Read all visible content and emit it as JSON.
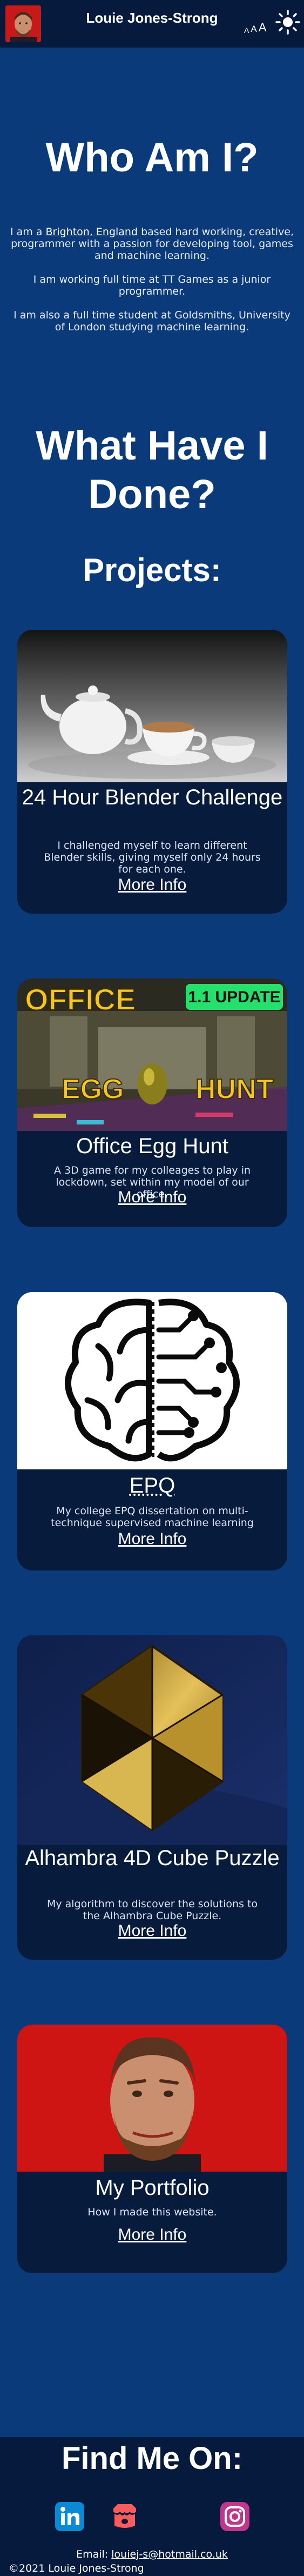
{
  "header": {
    "title": "Louie Jones-Strong",
    "font_size_glyphs": [
      "A",
      "A",
      "A"
    ]
  },
  "intro": {
    "heading": "Who Am I?",
    "p1_before": "I am a ",
    "p1_link": "Brighton, England",
    "p1_after": " based hard working, creative, programmer with a passion for developing tool, games and machine learning.",
    "p2": "I am working full time at TT Games as a junior programmer.",
    "p3": "I am also a full time student at Goldsmiths, University of London studying machine learning."
  },
  "done": {
    "heading": "What Have I Done?",
    "projects_heading": "Projects:"
  },
  "projects": [
    {
      "title": "24 Hour Blender Challenge",
      "description": "I challenged myself to learn different Blender skills, giving myself only 24 hours for each one.",
      "link": "More Info"
    },
    {
      "title": "Office Egg Hunt",
      "description": "A 3D game for my colleages to play in lockdown, set within my model of our office.",
      "link": "More Info",
      "image_text": {
        "office": "OFFICE",
        "egg": "EGG",
        "hunt": "HUNT",
        "badge": "1.1 UPDATE"
      }
    },
    {
      "title": "EPQ",
      "description": "My college EPQ dissertation on multi-technique supervised machine learning",
      "link": "More Info"
    },
    {
      "title": "Alhambra 4D Cube Puzzle",
      "description": "My algorithm to discover the solutions to the Alhambra Cube Puzzle.",
      "link": "More Info"
    },
    {
      "title": "My Portfolio",
      "description": "How I made this website.",
      "link": "More Info"
    }
  ],
  "footer": {
    "heading": "Find Me On:",
    "email_label": "Email: ",
    "email": "louiej-s@hotmail.co.uk",
    "copyright": "©2021 Louie Jones-Strong",
    "socials": [
      "linkedin-icon",
      "itch-io-icon",
      "github-icon",
      "instagram-icon"
    ]
  },
  "colors": {
    "page_bg": "#0b3a7a",
    "header_bg": "#061a3d",
    "card_bg": "#071c3d",
    "avatar_bg": "#c81919",
    "linkedin": "#0a8ad6",
    "itch": "#fa5c5c",
    "instagram": "#c1358a"
  }
}
